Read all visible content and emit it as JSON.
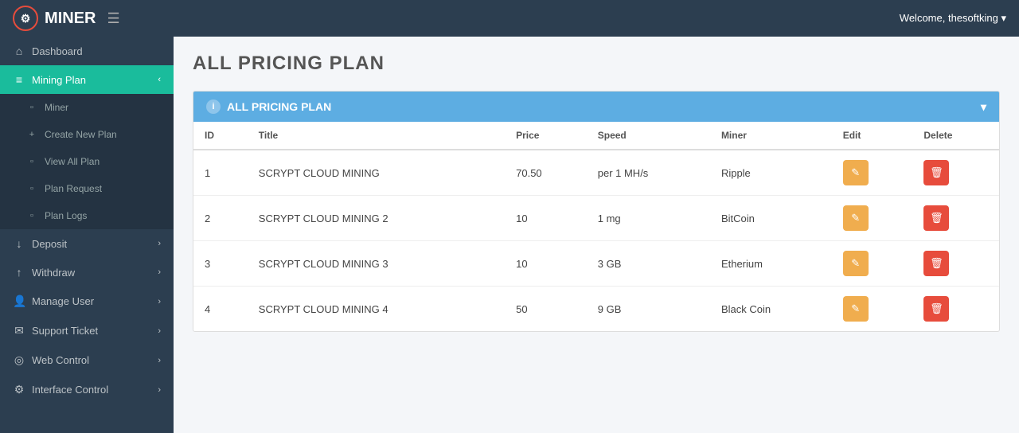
{
  "topnav": {
    "logo_text": "MINER",
    "logo_icon": "⚙",
    "welcome_text": "Welcome, thesoftking",
    "chevron": "▾"
  },
  "sidebar": {
    "items": [
      {
        "id": "dashboard",
        "label": "Dashboard",
        "icon": "⌂",
        "active": false,
        "sub": false
      },
      {
        "id": "mining-plan",
        "label": "Mining Plan",
        "icon": "≡",
        "active": true,
        "sub": false,
        "has_chevron": true
      },
      {
        "id": "miner",
        "label": "Miner",
        "icon": "▫",
        "active": false,
        "sub": true
      },
      {
        "id": "create-new-plan",
        "label": "Create New Plan",
        "icon": "+",
        "active": false,
        "sub": true
      },
      {
        "id": "view-all-plan",
        "label": "View All Plan",
        "icon": "▫",
        "active": false,
        "sub": true
      },
      {
        "id": "plan-request",
        "label": "Plan Request",
        "icon": "▫",
        "active": false,
        "sub": true
      },
      {
        "id": "plan-logs",
        "label": "Plan Logs",
        "icon": "▫",
        "active": false,
        "sub": true
      },
      {
        "id": "deposit",
        "label": "Deposit",
        "icon": "↓",
        "active": false,
        "sub": false,
        "has_chevron": true
      },
      {
        "id": "withdraw",
        "label": "Withdraw",
        "icon": "↑",
        "active": false,
        "sub": false,
        "has_chevron": true
      },
      {
        "id": "manage-user",
        "label": "Manage User",
        "icon": "👤",
        "active": false,
        "sub": false,
        "has_chevron": true
      },
      {
        "id": "support-ticket",
        "label": "Support Ticket",
        "icon": "🎫",
        "active": false,
        "sub": false,
        "has_chevron": true
      },
      {
        "id": "web-control",
        "label": "Web Control",
        "icon": "🌐",
        "active": false,
        "sub": false,
        "has_chevron": true
      },
      {
        "id": "interface-control",
        "label": "Interface Control",
        "icon": "⚙",
        "active": false,
        "sub": false,
        "has_chevron": true
      }
    ]
  },
  "page": {
    "title": "ALL PRICING PLAN",
    "panel_title": "ALL PRICING PLAN"
  },
  "table": {
    "columns": [
      "ID",
      "Title",
      "Price",
      "Speed",
      "Miner",
      "Edit",
      "Delete"
    ],
    "rows": [
      {
        "id": "1",
        "title": "SCRYPT CLOUD MINING",
        "price": "70.50",
        "speed": "per 1 MH/s",
        "miner": "Ripple"
      },
      {
        "id": "2",
        "title": "SCRYPT CLOUD MINING 2",
        "price": "10",
        "speed": "1 mg",
        "miner": "BitCoin"
      },
      {
        "id": "3",
        "title": "SCRYPT CLOUD MINING 3",
        "price": "10",
        "speed": "3 GB",
        "miner": "Etherium"
      },
      {
        "id": "4",
        "title": "SCRYPT CLOUD MINING 4",
        "price": "50",
        "speed": "9 GB",
        "miner": "Black Coin"
      }
    ]
  },
  "icons": {
    "edit": "✎",
    "delete": "🗑",
    "info": "i",
    "chevron_down": "▾",
    "chevron_left": "‹"
  },
  "colors": {
    "sidebar_active": "#1abc9c",
    "panel_header": "#5dade2",
    "edit_btn": "#f0ad4e",
    "delete_btn": "#e74c3c"
  }
}
